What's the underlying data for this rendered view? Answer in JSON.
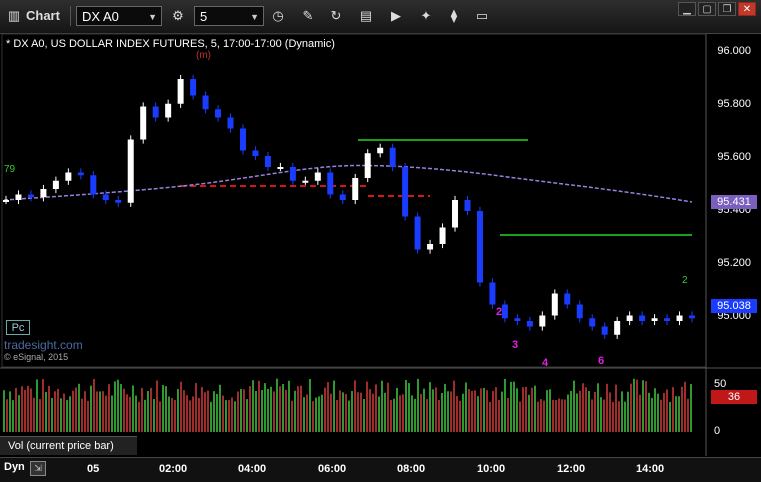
{
  "window": {
    "title": "Chart",
    "symbol": "DX A0",
    "interval": "5"
  },
  "chart": {
    "title": "* DX A0, US DOLLAR INDEX FUTURES, 5, 17:00-17:00 (Dynamic)",
    "price_ticks": [
      "96.000",
      "95.800",
      "95.600",
      "95.400",
      "95.200",
      "95.000"
    ],
    "last_price": "95.038",
    "ma_price": "95.431",
    "copyright": "© eSignal, 2015",
    "watermark": "tradesight.com",
    "pc_label": "Pc"
  },
  "volume": {
    "label": "Vol (current price bar)",
    "ticks": [
      "50",
      "0"
    ],
    "current": "36"
  },
  "time_axis": {
    "dyn_label": "Dyn",
    "labels": [
      "05",
      "02:00",
      "04:00",
      "06:00",
      "08:00",
      "10:00",
      "12:00",
      "14:00"
    ]
  },
  "colors": {
    "up": "#ffffff",
    "down": "#1a3cff",
    "ma": "#9b7fdd",
    "pivot_red": "#d01818",
    "pivot_green": "#18a018",
    "vol_up": "#3fcc3f",
    "vol_down": "#d63a3a"
  },
  "icons": [
    "back-icon",
    "chart-icon",
    "search-icon",
    "settings-icon",
    "clock-icon",
    "pencil-icon",
    "refresh-icon",
    "ticker-icon",
    "play-icon",
    "tools-icon",
    "comment-icon"
  ],
  "chart_data": {
    "type": "candlestick",
    "series": [
      {
        "name": "DX A0",
        "values": [
          95.48,
          95.5,
          95.49,
          95.52,
          95.55,
          95.58,
          95.57,
          95.5,
          95.48,
          95.47,
          95.7,
          95.82,
          95.78,
          95.83,
          95.92,
          95.86,
          95.81,
          95.78,
          95.74,
          95.66,
          95.64,
          95.6,
          95.6,
          95.55,
          95.55,
          95.58,
          95.5,
          95.48,
          95.56,
          95.65,
          95.67,
          95.6,
          95.42,
          95.3,
          95.32,
          95.38,
          95.48,
          95.44,
          95.18,
          95.1,
          95.05,
          95.04,
          95.02,
          95.06,
          95.14,
          95.1,
          95.05,
          95.02,
          94.99,
          95.04,
          95.06,
          95.04,
          95.05,
          95.04,
          95.06,
          95.05
        ]
      }
    ],
    "ylim": [
      94.88,
      96.08
    ]
  }
}
